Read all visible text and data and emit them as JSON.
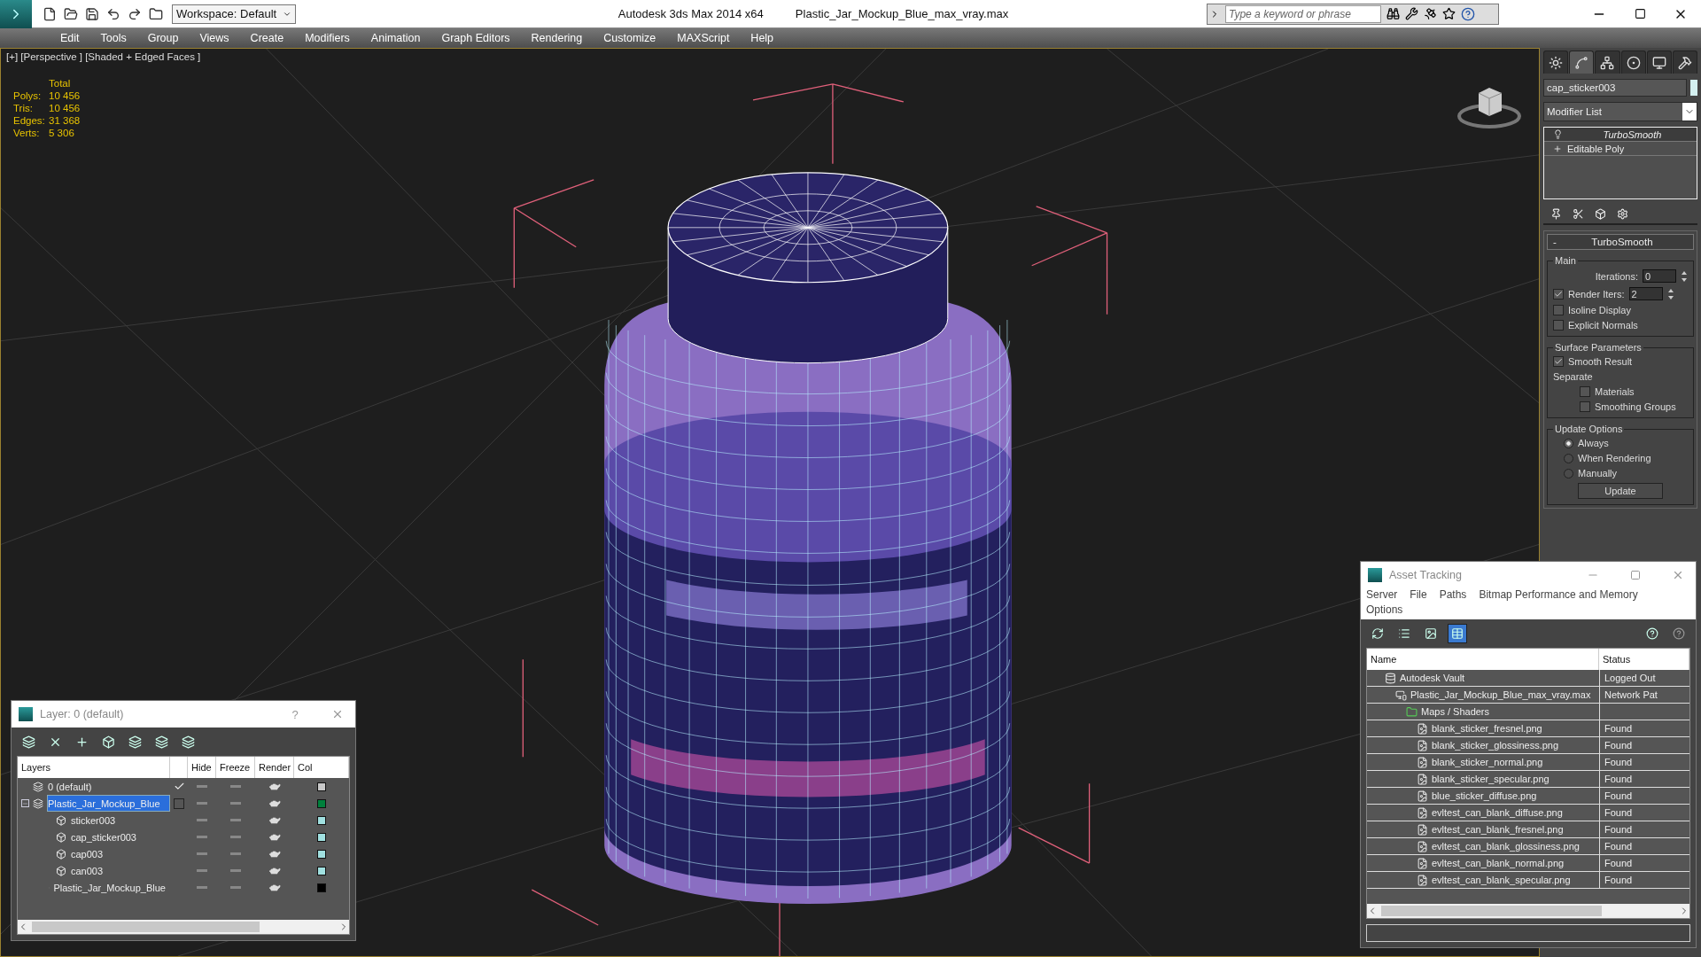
{
  "title_bar": {
    "workspace": "Workspace: Default",
    "app_title": "Autodesk 3ds Max  2014 x64",
    "file_name": "Plastic_Jar_Mockup_Blue_max_vray.max",
    "search": {
      "placeholder": "Type a keyword or phrase"
    }
  },
  "menu": [
    "Edit",
    "Tools",
    "Group",
    "Views",
    "Create",
    "Modifiers",
    "Animation",
    "Graph Editors",
    "Rendering",
    "Customize",
    "MAXScript",
    "Help"
  ],
  "viewport": {
    "label": "[+] [Perspective ] [Shaded + Edged Faces ]",
    "stats_header": "Total",
    "stats": [
      {
        "label": "Polys:",
        "value": "10 456"
      },
      {
        "label": "Tris:",
        "value": "10 456"
      },
      {
        "label": "Edges:",
        "value": "31 368"
      },
      {
        "label": "Verts:",
        "value": "5 306"
      }
    ]
  },
  "command_panel": {
    "tabs": [
      {
        "kind": "create",
        "selected": false
      },
      {
        "kind": "modify",
        "selected": true
      },
      {
        "kind": "hierarchy",
        "selected": false
      },
      {
        "kind": "motion",
        "selected": false
      },
      {
        "kind": "display",
        "selected": false
      },
      {
        "kind": "utilities",
        "selected": false
      }
    ],
    "object": {
      "name": "cap_sticker003",
      "color": "#d4f0f0"
    },
    "modifier_list": "Modifier List",
    "stack": [
      {
        "kind": "modifier",
        "label": "TurboSmooth",
        "selected": true
      },
      {
        "kind": "base",
        "label": "Editable Poly",
        "selected": false
      }
    ],
    "rollout": {
      "collapse": "-",
      "title": "TurboSmooth",
      "groups": [
        {
          "title": "Main",
          "items": [
            {
              "kind": "spinner",
              "label": "Iterations:",
              "value": "0"
            },
            {
              "kind": "check_spinner",
              "label": "Render Iters:",
              "checked": true,
              "value": "2"
            },
            {
              "kind": "checkbox",
              "label": "Isoline Display",
              "checked": false
            },
            {
              "kind": "checkbox",
              "label": "Explicit Normals",
              "checked": false
            }
          ]
        },
        {
          "title": "Surface Parameters",
          "items": [
            {
              "kind": "checkbox",
              "label": "Smooth Result",
              "checked": true
            },
            {
              "kind": "label",
              "label": "Separate"
            },
            {
              "kind": "sub_checkbox",
              "label": "Materials",
              "checked": false
            },
            {
              "kind": "sub_checkbox",
              "label": "Smoothing Groups",
              "checked": false
            }
          ]
        },
        {
          "title": "Update Options",
          "items": [
            {
              "kind": "radio",
              "label": "Always",
              "selected": true
            },
            {
              "kind": "radio",
              "label": "When Rendering",
              "selected": false
            },
            {
              "kind": "radio",
              "label": "Manually",
              "selected": false
            },
            {
              "kind": "button",
              "label": "Update"
            }
          ]
        }
      ]
    }
  },
  "layer_window": {
    "title": "Layer: 0 (default)",
    "help": "?",
    "columns": [
      "Layers",
      "Hide",
      "Freeze",
      "Render",
      "Col"
    ],
    "rows": [
      {
        "kind": "layer",
        "name": "0 (default)",
        "current": true,
        "selected": false,
        "color": "#c8c8c8"
      },
      {
        "kind": "layer",
        "name": "Plastic_Jar_Mockup_Blue",
        "current": false,
        "selected": true,
        "expanded": true,
        "color": "#00803c",
        "children": [
          {
            "kind": "object",
            "name": "sticker003",
            "selected": false,
            "color": "#a0e0e0"
          },
          {
            "kind": "object",
            "name": "cap_sticker003",
            "selected": false,
            "color": "#a0e0e0"
          },
          {
            "kind": "object",
            "name": "cap003",
            "selected": false,
            "color": "#a0e0e0"
          },
          {
            "kind": "object",
            "name": "can003",
            "selected": false,
            "color": "#a0e0e0"
          },
          {
            "kind": "object",
            "name": "Plastic_Jar_Mockup_Blue",
            "selected": false,
            "color": "#000000"
          }
        ]
      }
    ]
  },
  "asset_window": {
    "title": "Asset Tracking",
    "menu": [
      "Server",
      "File",
      "Paths",
      "Bitmap Performance and Memory",
      "Options"
    ],
    "view_buttons": [
      {
        "kind": "refresh",
        "selected": false
      },
      {
        "kind": "list",
        "selected": false
      },
      {
        "kind": "thumbnails",
        "selected": false
      },
      {
        "kind": "table",
        "selected": true
      }
    ],
    "columns": [
      "Name",
      "Status"
    ],
    "rows": [
      {
        "kind": "vault",
        "name": "Autodesk Vault",
        "status": "Logged Out",
        "children": [
          {
            "kind": "max",
            "name": "Plastic_Jar_Mockup_Blue_max_vray.max",
            "status": "Network Pat",
            "children": [
              {
                "kind": "folder",
                "name": "Maps / Shaders",
                "children": [
                  {
                    "kind": "file",
                    "name": "blank_sticker_fresnel.png",
                    "status": "Found"
                  },
                  {
                    "kind": "file",
                    "name": "blank_sticker_glossiness.png",
                    "status": "Found"
                  },
                  {
                    "kind": "file",
                    "name": "blank_sticker_normal.png",
                    "status": "Found"
                  },
                  {
                    "kind": "file",
                    "name": "blank_sticker_specular.png",
                    "status": "Found"
                  },
                  {
                    "kind": "file",
                    "name": "blue_sticker_diffuse.png",
                    "status": "Found"
                  },
                  {
                    "kind": "file",
                    "name": "evltest_can_blank_diffuse.png",
                    "status": "Found"
                  },
                  {
                    "kind": "file",
                    "name": "evltest_can_blank_fresnel.png",
                    "status": "Found"
                  },
                  {
                    "kind": "file",
                    "name": "evltest_can_blank_glossiness.png",
                    "status": "Found"
                  },
                  {
                    "kind": "file",
                    "name": "evltest_can_blank_normal.png",
                    "status": "Found"
                  },
                  {
                    "kind": "file",
                    "name": "evltest_can_blank_specular.png",
                    "status": "Found"
                  }
                ]
              }
            ]
          }
        ]
      }
    ]
  }
}
